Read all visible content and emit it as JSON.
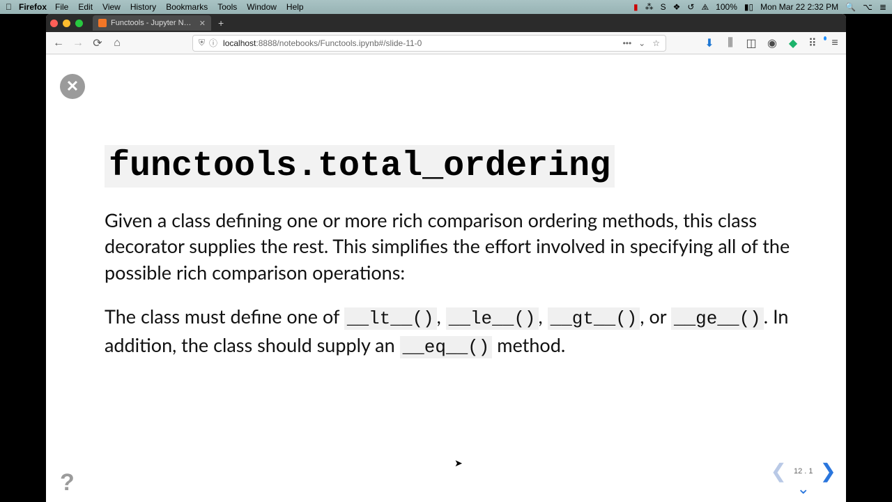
{
  "menubar": {
    "app": "Firefox",
    "items": [
      "File",
      "Edit",
      "View",
      "History",
      "Bookmarks",
      "Tools",
      "Window",
      "Help"
    ],
    "battery": "100%",
    "clock": "Mon Mar 22  2:32 PM"
  },
  "browser": {
    "tab_title": "Functools - Jupyter Notebook",
    "url_host": "localhost",
    "url_rest": ":8888/notebooks/Functools.ipynb#/slide-11-0"
  },
  "slide": {
    "title": "functools.total_ordering",
    "p1": "Given a class defining one or more rich comparison ordering methods, this class decorator supplies the rest. This simplifies the effort involved in specifying all of the possible rich comparison operations:",
    "p2_a": "The class must define one of ",
    "code_lt": "__lt__()",
    "sep1": ", ",
    "code_le": "__le__()",
    "sep2": ", ",
    "code_gt": "__gt__()",
    "sep3": ", or ",
    "code_ge": "__ge__()",
    "p2_b": ". In addition, the class should supply an ",
    "code_eq": "__eq__()",
    "p2_c": " method.",
    "counter": "12 . 1"
  },
  "glyphs": {
    "apple": "",
    "close_x": "✕",
    "plus": "+",
    "back": "←",
    "fwd": "→",
    "reload": "⟳",
    "home": "⌂",
    "shield": "⛨",
    "info": "ⓘ",
    "dots": "•••",
    "pocket": "⌄",
    "star": "☆",
    "download": "⬇",
    "library": "⫼",
    "sidebar": "◫",
    "account": "◉",
    "ext1": "◆",
    "ext2": "⠿",
    "menu": "≡",
    "help": "?",
    "left": "❮",
    "right": "❯",
    "down": "⌄",
    "wifi": "⧌",
    "batt": "▮▯",
    "search": "🔍",
    "ctlctr": "⌥",
    "list": "≣",
    "dropbox": "⁂",
    "slack": "S",
    "squares": "❖",
    "clockicon": "↺"
  }
}
